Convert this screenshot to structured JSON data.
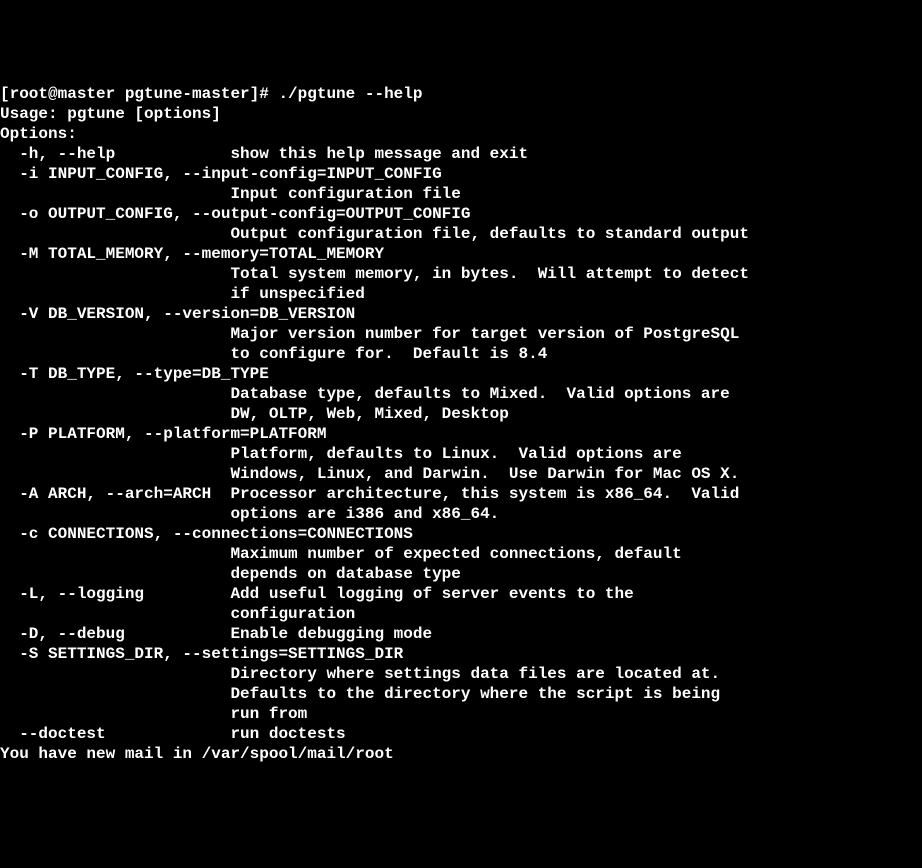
{
  "lines": [
    "[root@master pgtune-master]# ./pgtune --help",
    "Usage: pgtune [options]",
    "",
    "Options:",
    "  -h, --help            show this help message and exit",
    "  -i INPUT_CONFIG, --input-config=INPUT_CONFIG",
    "                        Input configuration file",
    "  -o OUTPUT_CONFIG, --output-config=OUTPUT_CONFIG",
    "                        Output configuration file, defaults to standard output",
    "  -M TOTAL_MEMORY, --memory=TOTAL_MEMORY",
    "                        Total system memory, in bytes.  Will attempt to detect",
    "                        if unspecified",
    "  -V DB_VERSION, --version=DB_VERSION",
    "                        Major version number for target version of PostgreSQL",
    "                        to configure for.  Default is 8.4",
    "  -T DB_TYPE, --type=DB_TYPE",
    "                        Database type, defaults to Mixed.  Valid options are",
    "                        DW, OLTP, Web, Mixed, Desktop",
    "  -P PLATFORM, --platform=PLATFORM",
    "                        Platform, defaults to Linux.  Valid options are",
    "                        Windows, Linux, and Darwin.  Use Darwin for Mac OS X.",
    "  -A ARCH, --arch=ARCH  Processor architecture, this system is x86_64.  Valid",
    "                        options are i386 and x86_64.",
    "  -c CONNECTIONS, --connections=CONNECTIONS",
    "                        Maximum number of expected connections, default",
    "                        depends on database type",
    "  -L, --logging         Add useful logging of server events to the",
    "                        configuration",
    "  -D, --debug           Enable debugging mode",
    "  -S SETTINGS_DIR, --settings=SETTINGS_DIR",
    "                        Directory where settings data files are located at.",
    "                        Defaults to the directory where the script is being",
    "                        run from",
    "  --doctest             run doctests",
    "You have new mail in /var/spool/mail/root"
  ]
}
